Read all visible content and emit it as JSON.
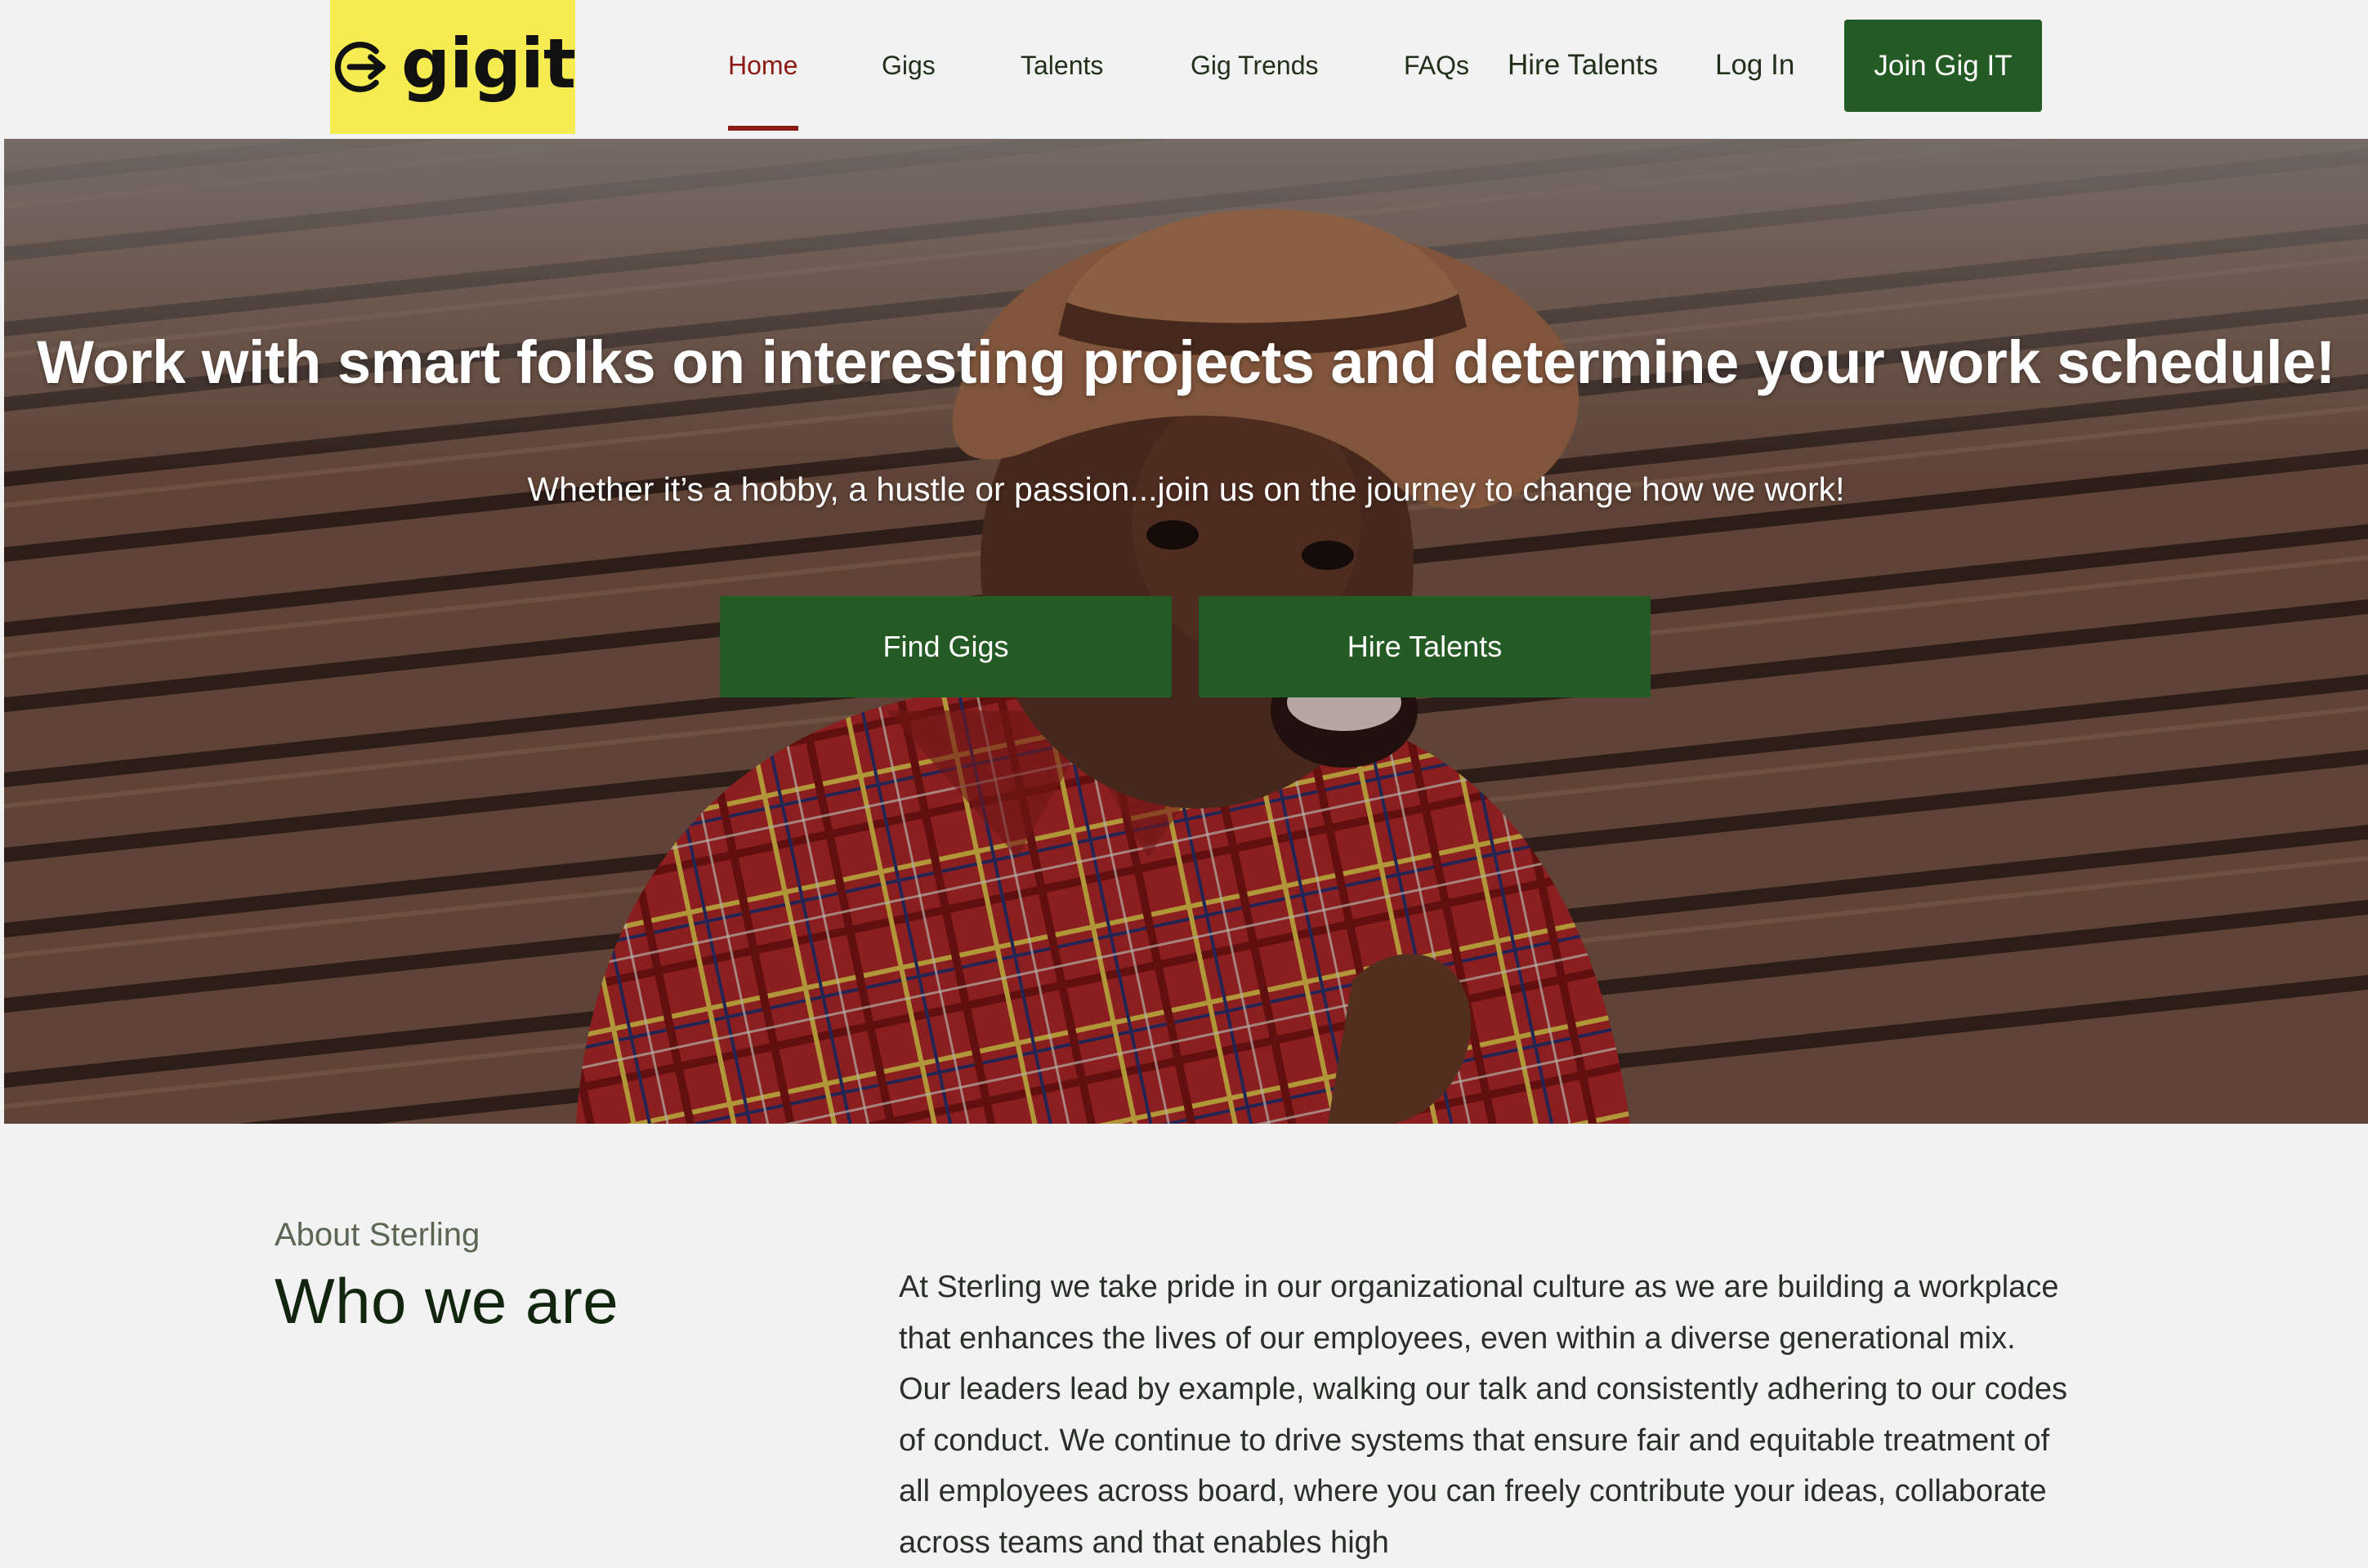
{
  "brand": {
    "logo_text": "gigit",
    "logo_color": "#f5ec52"
  },
  "nav": {
    "items": [
      {
        "label": "Home",
        "active": true
      },
      {
        "label": "Gigs"
      },
      {
        "label": "Talents"
      },
      {
        "label": "Gig Trends"
      },
      {
        "label": "FAQs"
      },
      {
        "label": "Hire Talents"
      },
      {
        "label": "Log In"
      }
    ],
    "cta_label": "Join Gig IT"
  },
  "hero": {
    "title": "Work with smart folks on interesting projects and determine your work schedule!",
    "subtitle": "Whether it’s a hobby, a hustle or passion...join us on the journey to change how we work!",
    "buttons": {
      "find_gigs": "Find Gigs",
      "hire_talents": "Hire Talents"
    }
  },
  "about": {
    "eyebrow": "About Sterling",
    "heading": "Who we are",
    "body": "At Sterling we take pride in our organizational culture as we are building a workplace that enhances the lives of our employees, even within a diverse generational mix. Our leaders lead by example, walking our talk and consistently adhering to our codes of conduct. We continue to drive systems that ensure fair and equitable treatment of all employees across board, where you can freely contribute your ideas, collaborate across teams and that enables high"
  },
  "colors": {
    "primary_green": "#245a23",
    "active_red": "#8b1a14",
    "background": "#f2f2f2"
  }
}
